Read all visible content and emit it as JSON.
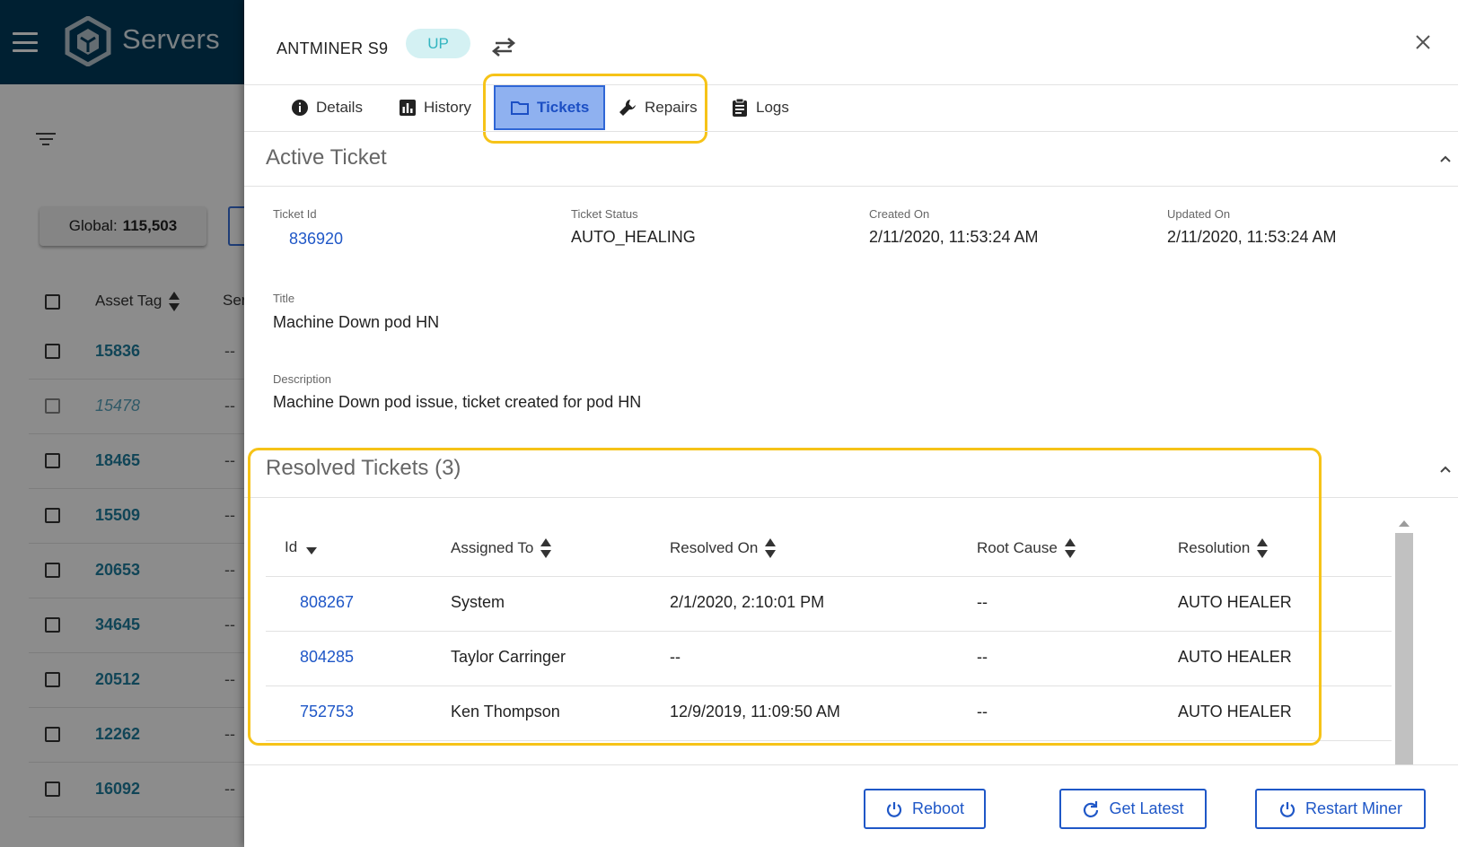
{
  "app": {
    "title": "Servers",
    "global_label": "Global:",
    "global_value": "115,503",
    "table": {
      "header_asset_tag": "Asset Tag",
      "header_second": "Ser",
      "rows": [
        {
          "tag": "15836",
          "dash": "--",
          "style": "normal"
        },
        {
          "tag": "15478",
          "dash": "--",
          "style": "italic"
        },
        {
          "tag": "18465",
          "dash": "--",
          "style": "normal"
        },
        {
          "tag": "15509",
          "dash": "--",
          "style": "normal"
        },
        {
          "tag": "20653",
          "dash": "--",
          "style": "normal"
        },
        {
          "tag": "34645",
          "dash": "--",
          "style": "normal"
        },
        {
          "tag": "20512",
          "dash": "--",
          "style": "normal"
        },
        {
          "tag": "12262",
          "dash": "--",
          "style": "normal"
        },
        {
          "tag": "16092",
          "dash": "--",
          "style": "normal"
        }
      ]
    }
  },
  "drawer": {
    "device_name": "ANTMINER S9",
    "status": "UP",
    "colors": {
      "accent": "#1f57c7",
      "status_bg": "#d4f1f3",
      "status_text": "#33b5c0",
      "highlight": "#f6c318",
      "header_bg": "#003b5c"
    },
    "tabs": [
      {
        "label": "Details",
        "icon": "info-icon",
        "active": false
      },
      {
        "label": "History",
        "icon": "bar-chart-icon",
        "active": false
      },
      {
        "label": "Tickets",
        "icon": "folder-icon",
        "active": true
      },
      {
        "label": "Repairs",
        "icon": "wrench-icon",
        "active": false
      },
      {
        "label": "Logs",
        "icon": "clipboard-icon",
        "active": false
      }
    ],
    "active_ticket": {
      "section_title": "Active Ticket",
      "ticket_id_label": "Ticket Id",
      "ticket_id": "836920",
      "status_label": "Ticket Status",
      "status": "AUTO_HEALING",
      "created_label": "Created On",
      "created": "2/11/2020, 11:53:24 AM",
      "updated_label": "Updated On",
      "updated": "2/11/2020, 11:53:24 AM",
      "title_label": "Title",
      "title": "Machine Down pod HN",
      "description_label": "Description",
      "description": "Machine Down pod issue, ticket created for pod HN"
    },
    "resolved": {
      "section_title": "Resolved Tickets (3)",
      "columns": [
        "Id",
        "Assigned To",
        "Resolved On",
        "Root Cause",
        "Resolution"
      ],
      "rows": [
        {
          "id": "808267",
          "assigned_to": "System",
          "resolved_on": "2/1/2020, 2:10:01 PM",
          "root_cause": "--",
          "resolution": "AUTO HEALER"
        },
        {
          "id": "804285",
          "assigned_to": "Taylor Carringer",
          "resolved_on": "--",
          "root_cause": "--",
          "resolution": "AUTO HEALER"
        },
        {
          "id": "752753",
          "assigned_to": "Ken Thompson",
          "resolved_on": "12/9/2019, 11:09:50 AM",
          "root_cause": "--",
          "resolution": "AUTO HEALER"
        }
      ]
    },
    "actions": {
      "reboot": "Reboot",
      "get_latest": "Get Latest",
      "restart_miner": "Restart Miner"
    }
  }
}
